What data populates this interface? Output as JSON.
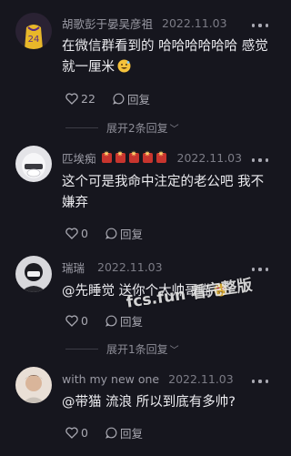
{
  "comments": [
    {
      "username": "胡歌彭于晏吴彦祖",
      "date": "2022.11.03",
      "text": "在微信群看到的 哈哈哈哈哈哈 感觉就一厘米",
      "like_count": "22",
      "reply_label": "回复",
      "expand_label": "展开2条回复"
    },
    {
      "username": "匹埃痴",
      "date": "2022.11.03",
      "text": "这个可是我命中注定的老公吧 我不嫌弃",
      "like_count": "0",
      "reply_label": "回复"
    },
    {
      "username": "瑞瑞",
      "date": "2022.11.03",
      "text": "@先睡觉  送你个大帅哥喵",
      "like_count": "0",
      "reply_label": "回复",
      "expand_label": "展开1条回复"
    },
    {
      "username": "with my new one",
      "date": "2022.11.03",
      "text": "@带猫 流浪  所以到底有多帅?",
      "like_count": "0",
      "reply_label": "回复"
    }
  ],
  "watermark": "fcs.fun 看完整版",
  "colors": {
    "background": "#16161e",
    "text_primary": "#ececf0",
    "text_secondary": "#9a9aa4"
  }
}
